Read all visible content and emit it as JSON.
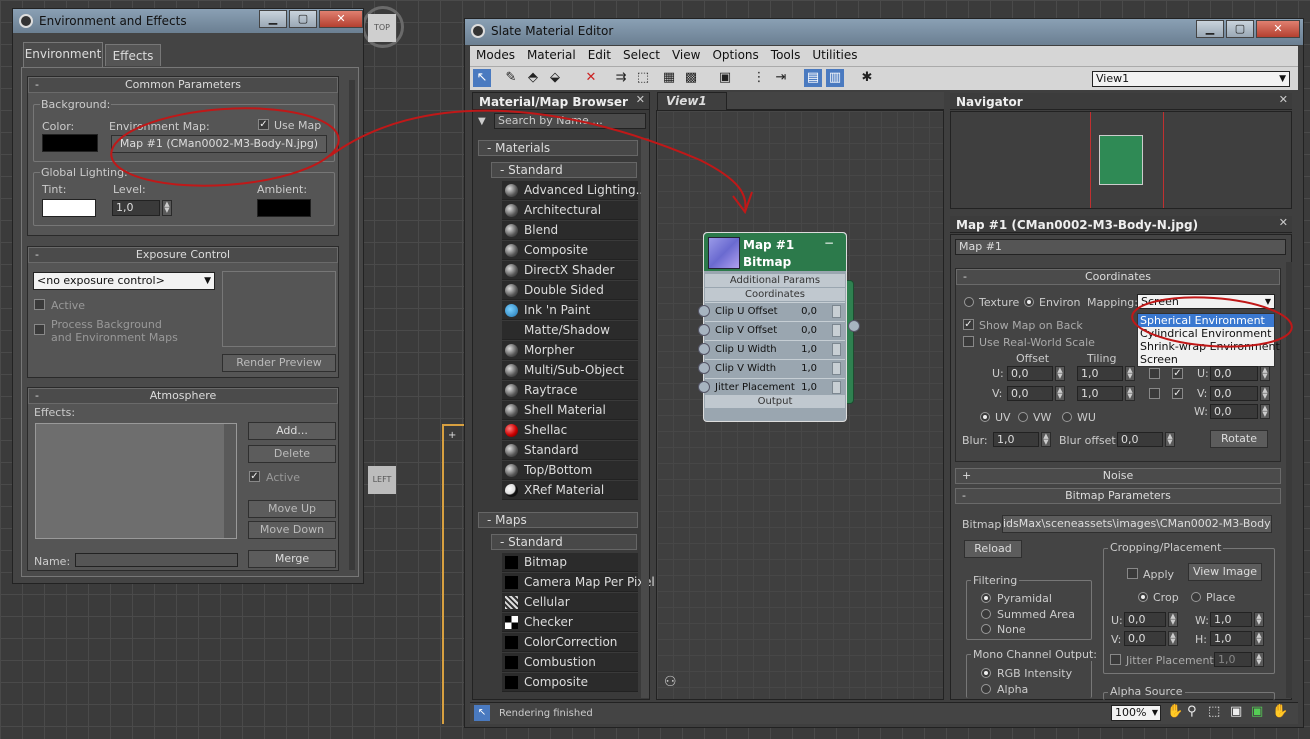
{
  "env_window": {
    "title": "Environment and Effects",
    "tabs": [
      "Environment",
      "Effects"
    ],
    "common": {
      "header": "Common Parameters",
      "background_label": "Background:",
      "color_label": "Color:",
      "env_map_label": "Environment Map:",
      "use_map_label": "Use Map",
      "map_button": "Map #1 (CMan0002-M3-Body-N.jpg)",
      "global_lighting_label": "Global Lighting:",
      "tint_label": "Tint:",
      "level_label": "Level:",
      "level_value": "1,0",
      "ambient_label": "Ambient:"
    },
    "exposure": {
      "header": "Exposure Control",
      "dropdown": "<no exposure control>",
      "active_label": "Active",
      "process_label_1": "Process Background",
      "process_label_2": "and Environment Maps",
      "render_preview": "Render Preview"
    },
    "atmosphere": {
      "header": "Atmosphere",
      "effects_label": "Effects:",
      "add": "Add...",
      "delete": "Delete",
      "active_label": "Active",
      "move_up": "Move Up",
      "move_down": "Move Down",
      "name_label": "Name:",
      "merge": "Merge"
    }
  },
  "viewport_labels": {
    "top": "TOP",
    "left": "LEFT",
    "corner": "+"
  },
  "sme": {
    "title": "Slate Material Editor",
    "menu": [
      "Modes",
      "Material",
      "Edit",
      "Select",
      "View",
      "Options",
      "Tools",
      "Utilities"
    ],
    "view_dropdown": "View1",
    "browser": {
      "title": "Material/Map Browser",
      "search_placeholder": "Search by Name ...",
      "materials_label": "Materials",
      "standard_label": "Standard",
      "materials": [
        "Advanced Lighting...",
        "Architectural",
        "Blend",
        "Composite",
        "DirectX Shader",
        "Double Sided",
        "Ink 'n Paint",
        "Matte/Shadow",
        "Morpher",
        "Multi/Sub-Object",
        "Raytrace",
        "Shell Material",
        "Shellac",
        "Standard",
        "Top/Bottom",
        "XRef Material"
      ],
      "maps_label": "Maps",
      "maps_standard_label": "Standard",
      "maps": [
        "Bitmap",
        "Camera Map Per Pixel",
        "Cellular",
        "Checker",
        "ColorCorrection",
        "Combustion",
        "Composite"
      ]
    },
    "view_tab": "View1",
    "node": {
      "title_1": "Map #1",
      "title_2": "Bitmap",
      "additional": "Additional Params",
      "coordinates": "Coordinates",
      "rows": [
        {
          "name": "Clip U Offset",
          "value": "0,0"
        },
        {
          "name": "Clip V Offset",
          "value": "0,0"
        },
        {
          "name": "Clip U Width",
          "value": "1,0"
        },
        {
          "name": "Clip V Width",
          "value": "1,0"
        },
        {
          "name": "Jitter Placement",
          "value": "1,0"
        }
      ],
      "output": "Output"
    },
    "navigator": {
      "title": "Navigator"
    },
    "props": {
      "title": "Map #1 (CMan0002-M3-Body-N.jpg)",
      "name_field": "Map #1",
      "coordinates_header": "Coordinates",
      "texture_label": "Texture",
      "environ_label": "Environ",
      "mapping_label": "Mapping:",
      "mapping_value": "Screen",
      "mapping_options": [
        "Spherical Environment",
        "Cylindrical Environment",
        "Shrink-wrap Environment",
        "Screen"
      ],
      "show_map_label": "Show Map on Back",
      "real_world_label": "Use Real-World Scale",
      "offset_label": "Offset",
      "tiling_label": "Tiling",
      "u_label": "U:",
      "v_label": "V:",
      "w_label": "W:",
      "u_offset": "0,0",
      "v_offset": "0,0",
      "u_tiling": "1,0",
      "v_tiling": "1,0",
      "u_angle": "0,0",
      "v_angle": "0,0",
      "w_angle": "0,0",
      "uv": "UV",
      "vw": "VW",
      "wu": "WU",
      "blur_label": "Blur:",
      "blur_value": "1,0",
      "blur_offset_label": "Blur offset:",
      "blur_offset_value": "0,0",
      "rotate": "Rotate",
      "noise_header": "Noise",
      "bitmap_params_header": "Bitmap Parameters",
      "bitmap_label": "Bitmap:",
      "bitmap_path": "idsMax\\sceneassets\\images\\CMan0002-M3-Body-N.jpg",
      "reload": "Reload",
      "cropping_label": "Cropping/Placement",
      "apply_label": "Apply",
      "view_image": "View Image",
      "crop_label": "Crop",
      "place_label": "Place",
      "filtering_label": "Filtering",
      "pyramidal": "Pyramidal",
      "summed": "Summed Area",
      "none": "None",
      "crop_u": "0,0",
      "crop_v": "0,0",
      "crop_w": "1,0",
      "crop_h": "1,0",
      "h_label": "H:",
      "jitter_label": "Jitter Placement:",
      "jitter_value": "1,0",
      "mono_label": "Mono Channel Output:",
      "rgb_intensity": "RGB Intensity",
      "alpha": "Alpha",
      "alpha_source": "Alpha Source"
    },
    "status": "Rendering finished",
    "zoom": "100%"
  }
}
